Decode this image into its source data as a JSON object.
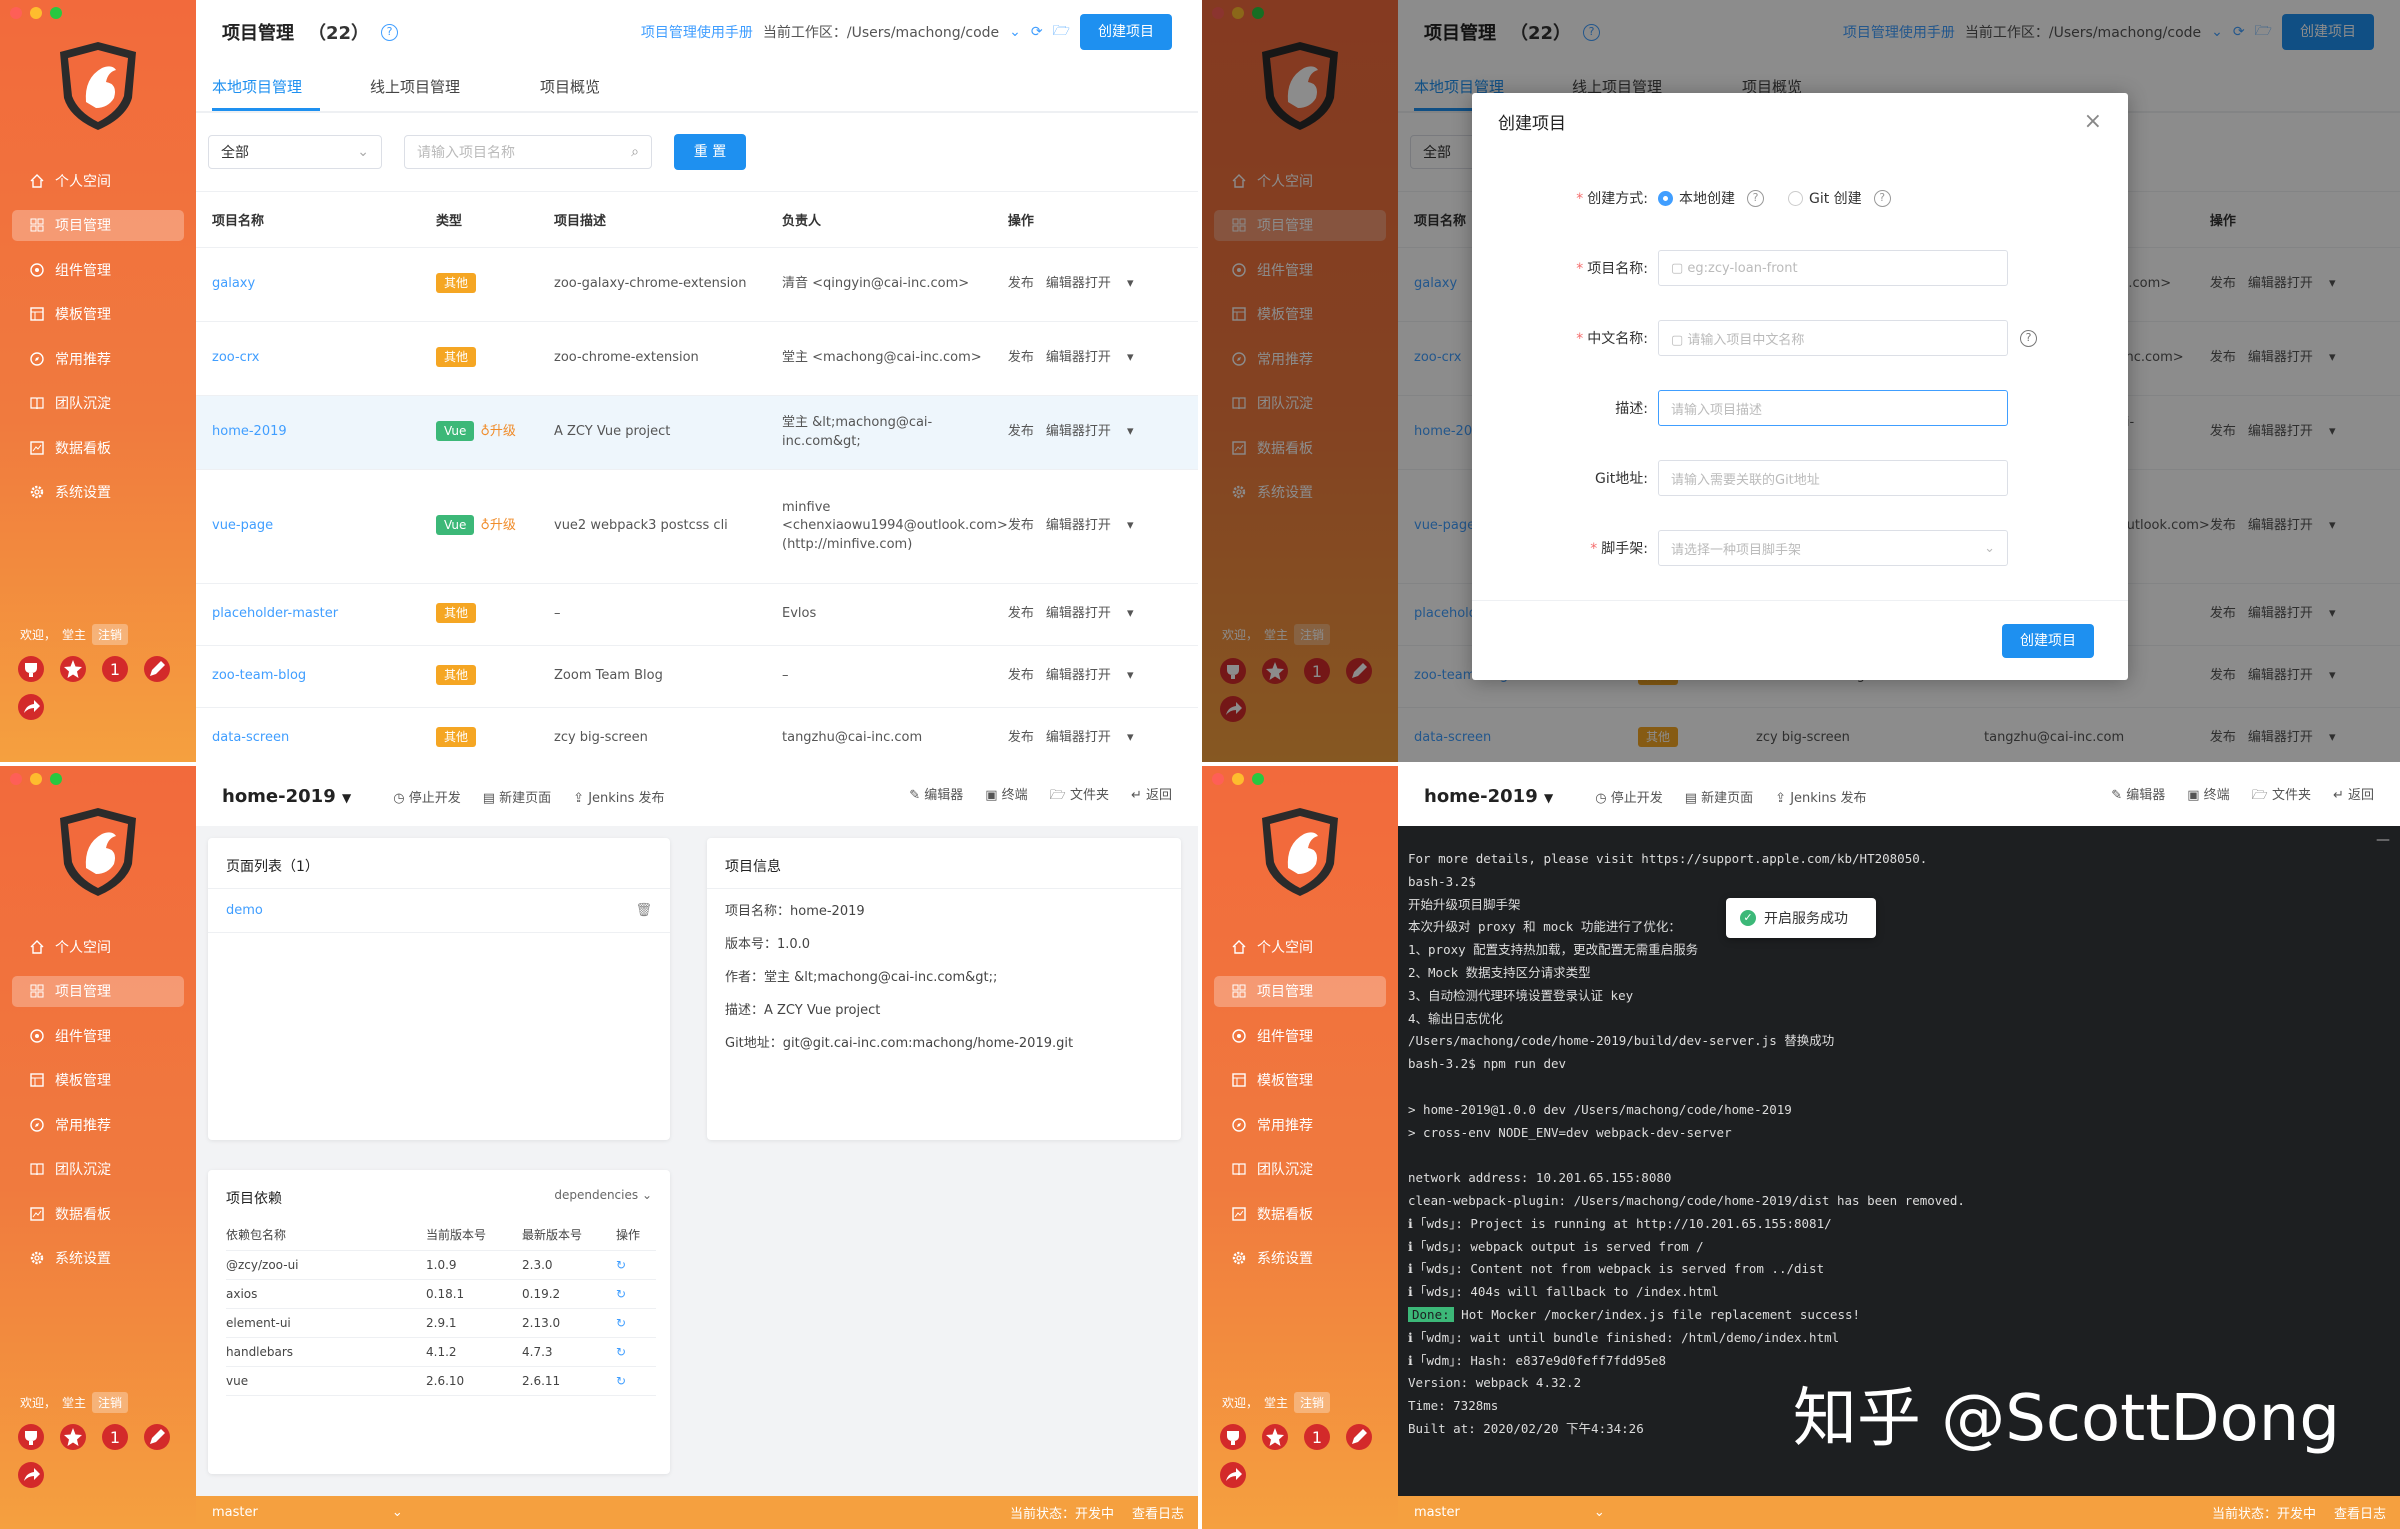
{
  "sidebar": {
    "nav": [
      {
        "label": "个人空间",
        "icon": "home-icon"
      },
      {
        "label": "项目管理",
        "icon": "grid-icon"
      },
      {
        "label": "组件管理",
        "icon": "component-icon"
      },
      {
        "label": "模板管理",
        "icon": "template-icon"
      },
      {
        "label": "常用推荐",
        "icon": "compass-icon"
      },
      {
        "label": "团队沉淀",
        "icon": "book-icon"
      },
      {
        "label": "数据看板",
        "icon": "chart-icon"
      },
      {
        "label": "系统设置",
        "icon": "gear-icon"
      }
    ],
    "welcome": "欢迎，",
    "user": "堂主",
    "logout": "注销",
    "badge_num": "1"
  },
  "header": {
    "title": "项目管理",
    "count": "（22）",
    "manual": "项目管理使用手册",
    "workspace": "当前工作区：/Users/machong/code",
    "create": "创建项目"
  },
  "tabs": [
    "本地项目管理",
    "线上项目管理",
    "项目概览"
  ],
  "filter": {
    "select": "全部",
    "search_placeholder": "请输入项目名称",
    "reset": "重 置"
  },
  "columns": [
    "项目名称",
    "类型",
    "项目描述",
    "负责人",
    "操作"
  ],
  "rows": [
    {
      "name": "galaxy",
      "type": "其他",
      "desc": "zoo-galaxy-chrome-extension",
      "owner": "清音 <qingyin@cai-inc.com>",
      "upgrade": ""
    },
    {
      "name": "zoo-crx",
      "type": "其他",
      "desc": "zoo-chrome-extension",
      "owner": "堂主 <machong@cai-inc.com>",
      "upgrade": ""
    },
    {
      "name": "home-2019",
      "type": "Vue",
      "desc": "A ZCY Vue project",
      "owner": "堂主 &lt;machong@cai-inc.com&gt;",
      "upgrade": "升级"
    },
    {
      "name": "vue-page",
      "type": "Vue",
      "desc": "vue2 webpack3 postcss cli",
      "owner": "minfive <chenxiaowu1994@outlook.com> (http://minfive.com)",
      "upgrade": "升级"
    },
    {
      "name": "placeholder-master",
      "type": "其他",
      "desc": "–",
      "owner": "Evlos",
      "upgrade": ""
    },
    {
      "name": "zoo-team-blog",
      "type": "其他",
      "desc": "Zoom Team Blog",
      "owner": "–",
      "upgrade": ""
    },
    {
      "name": "data-screen",
      "type": "其他",
      "desc": "zcy big-screen",
      "owner": "tangzhu@cai-inc.com",
      "upgrade": ""
    }
  ],
  "ops": {
    "publish": "发布",
    "editor": "编辑器打开"
  },
  "modal": {
    "title": "创建项目",
    "method_label": "创建方式:",
    "opt_local": "本地创建",
    "opt_git": "Git 创建",
    "name_label": "项目名称:",
    "name_ph": "eg:zcy-loan-front",
    "cn_label": "中文名称:",
    "cn_ph": "请输入项目中文名称",
    "desc_label": "描述:",
    "desc_ph": "请输入项目描述",
    "git_label": "Git地址:",
    "git_ph": "请输入需要关联的Git地址",
    "scaffold_label": "脚手架:",
    "scaffold_ph": "请选择一种项目脚手架",
    "submit": "创建项目"
  },
  "detail": {
    "project": "home-2019",
    "actions": [
      "停止开发",
      "新建页面",
      "Jenkins 发布"
    ],
    "right_actions": [
      "编辑器",
      "终端",
      "文件夹",
      "返回"
    ],
    "actions_running": [
      "停止开发",
      "新建页面",
      "Jenkins 发布"
    ],
    "pages_title": "页面列表（1）",
    "page": "demo",
    "info_title": "项目信息",
    "info": [
      "项目名称：home-2019",
      "版本号：1.0.0",
      "作者：堂主 &lt;machong@cai-inc.com&gt;;",
      "描述：A ZCY Vue project",
      "Git地址：git@git.cai-inc.com:machong/home-2019.git"
    ],
    "deps_title": "项目依赖",
    "deps_select": "dependencies",
    "dep_cols": [
      "依赖包名称",
      "当前版本号",
      "最新版本号",
      "操作"
    ],
    "deps": [
      [
        "@zcy/zoo-ui",
        "1.0.9",
        "2.3.0"
      ],
      [
        "axios",
        "0.18.1",
        "0.19.2"
      ],
      [
        "element-ui",
        "2.9.1",
        "2.13.0"
      ],
      [
        "handlebars",
        "4.1.2",
        "4.7.3"
      ],
      [
        "vue",
        "2.6.10",
        "2.6.11"
      ]
    ],
    "branch": "master",
    "status": "当前状态：开发中",
    "log": "查看日志"
  },
  "terminal": {
    "lines": [
      "For more details, please visit https://support.apple.com/kb/HT208050.",
      "bash-3.2$",
      "开始升级项目脚手架",
      "本次升级对 proxy 和 mock 功能进行了优化：",
      "1、proxy 配置支持热加载，更改配置无需重启服务",
      "2、Mock 数据支持区分请求类型",
      "3、自动检测代理环境设置登录认证 key",
      "4、输出日志优化",
      "/Users/machong/code/home-2019/build/dev-server.js 替换成功",
      "bash-3.2$ npm run dev",
      "",
      "> home-2019@1.0.0 dev /Users/machong/code/home-2019",
      "> cross-env NODE_ENV=dev webpack-dev-server",
      "",
      "network address: 10.201.65.155:8080",
      "clean-webpack-plugin: /Users/machong/code/home-2019/dist has been removed.",
      "ℹ ｢wds｣: Project is running at http://10.201.65.155:8081/",
      "ℹ ｢wds｣: webpack output is served from /",
      "ℹ ｢wds｣: Content not from webpack is served from ../dist",
      "ℹ ｢wds｣: 404s will fallback to /index.html",
      "Done: Hot Mocker /mocker/index.js file replacement success!",
      "ℹ ｢wdm｣: wait until bundle finished: /html/demo/index.html",
      "ℹ ｢wdm｣: Hash: e837e9d0feff7fdd95e8",
      "Version: webpack 4.32.2",
      "Time: 7328ms",
      "Built at: 2020/02/20 下午4:34:26"
    ],
    "toast": "开启服务成功"
  },
  "watermark": "知乎 @ScottDong",
  "colors": {
    "accent": "#1e90f0",
    "sidebar": "#f26a3c",
    "tag_other": "#f5a623",
    "tag_vue": "#3cb878"
  }
}
